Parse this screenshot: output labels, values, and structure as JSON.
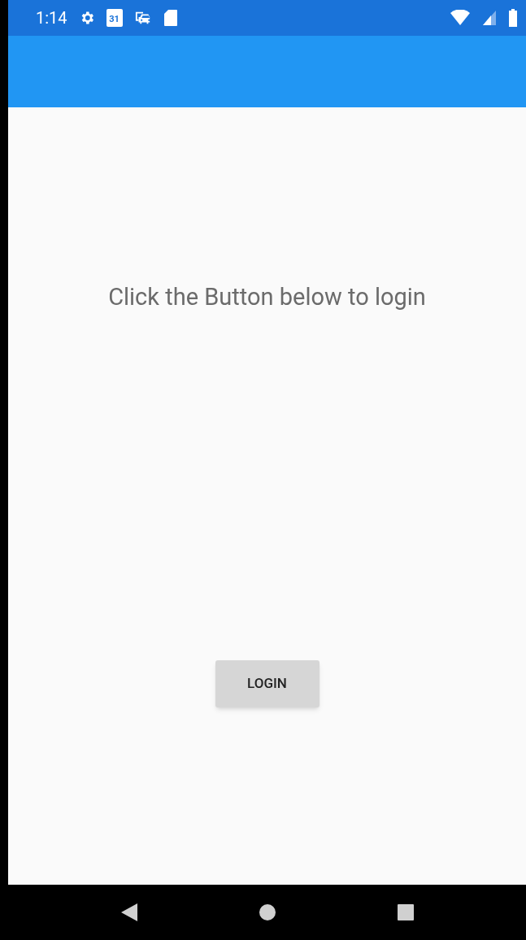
{
  "status_bar": {
    "time": "1:14",
    "calendar_day": "31"
  },
  "content": {
    "message": "Click the Button below to login",
    "button": "LOGIN"
  }
}
